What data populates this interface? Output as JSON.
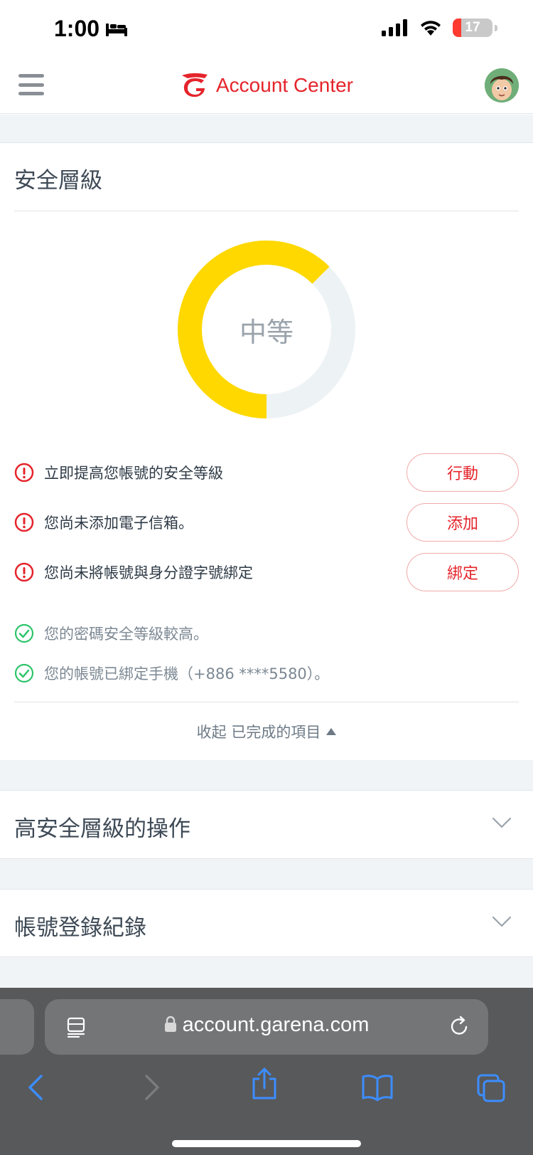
{
  "status_bar": {
    "time": "1:00",
    "battery": "17"
  },
  "header": {
    "title": "Account Center"
  },
  "security": {
    "title": "安全層級",
    "level": "中等",
    "level_fraction": 0.625,
    "colors": {
      "filled": "#ffd800",
      "empty": "#edf2f5"
    },
    "warnings": [
      {
        "text": "立即提高您帳號的安全等級",
        "action": "行動"
      },
      {
        "text": "您尚未添加電子信箱。",
        "action": "添加"
      },
      {
        "text": "您尚未將帳號與身分證字號綁定",
        "action": "綁定"
      }
    ],
    "completed": [
      {
        "text": "您的密碼安全等級較高。"
      },
      {
        "text": "您的帳號已綁定手機（+886 ****5580）。"
      }
    ],
    "collapse_label": "收起 已完成的項目"
  },
  "sections": [
    {
      "title": "高安全層級的操作"
    },
    {
      "title": "帳號登錄紀錄"
    }
  ],
  "browser": {
    "url": "account.garena.com"
  },
  "colors": {
    "accent": "#e5242b",
    "warning": "#e5242b",
    "success": "#2ec46a"
  }
}
